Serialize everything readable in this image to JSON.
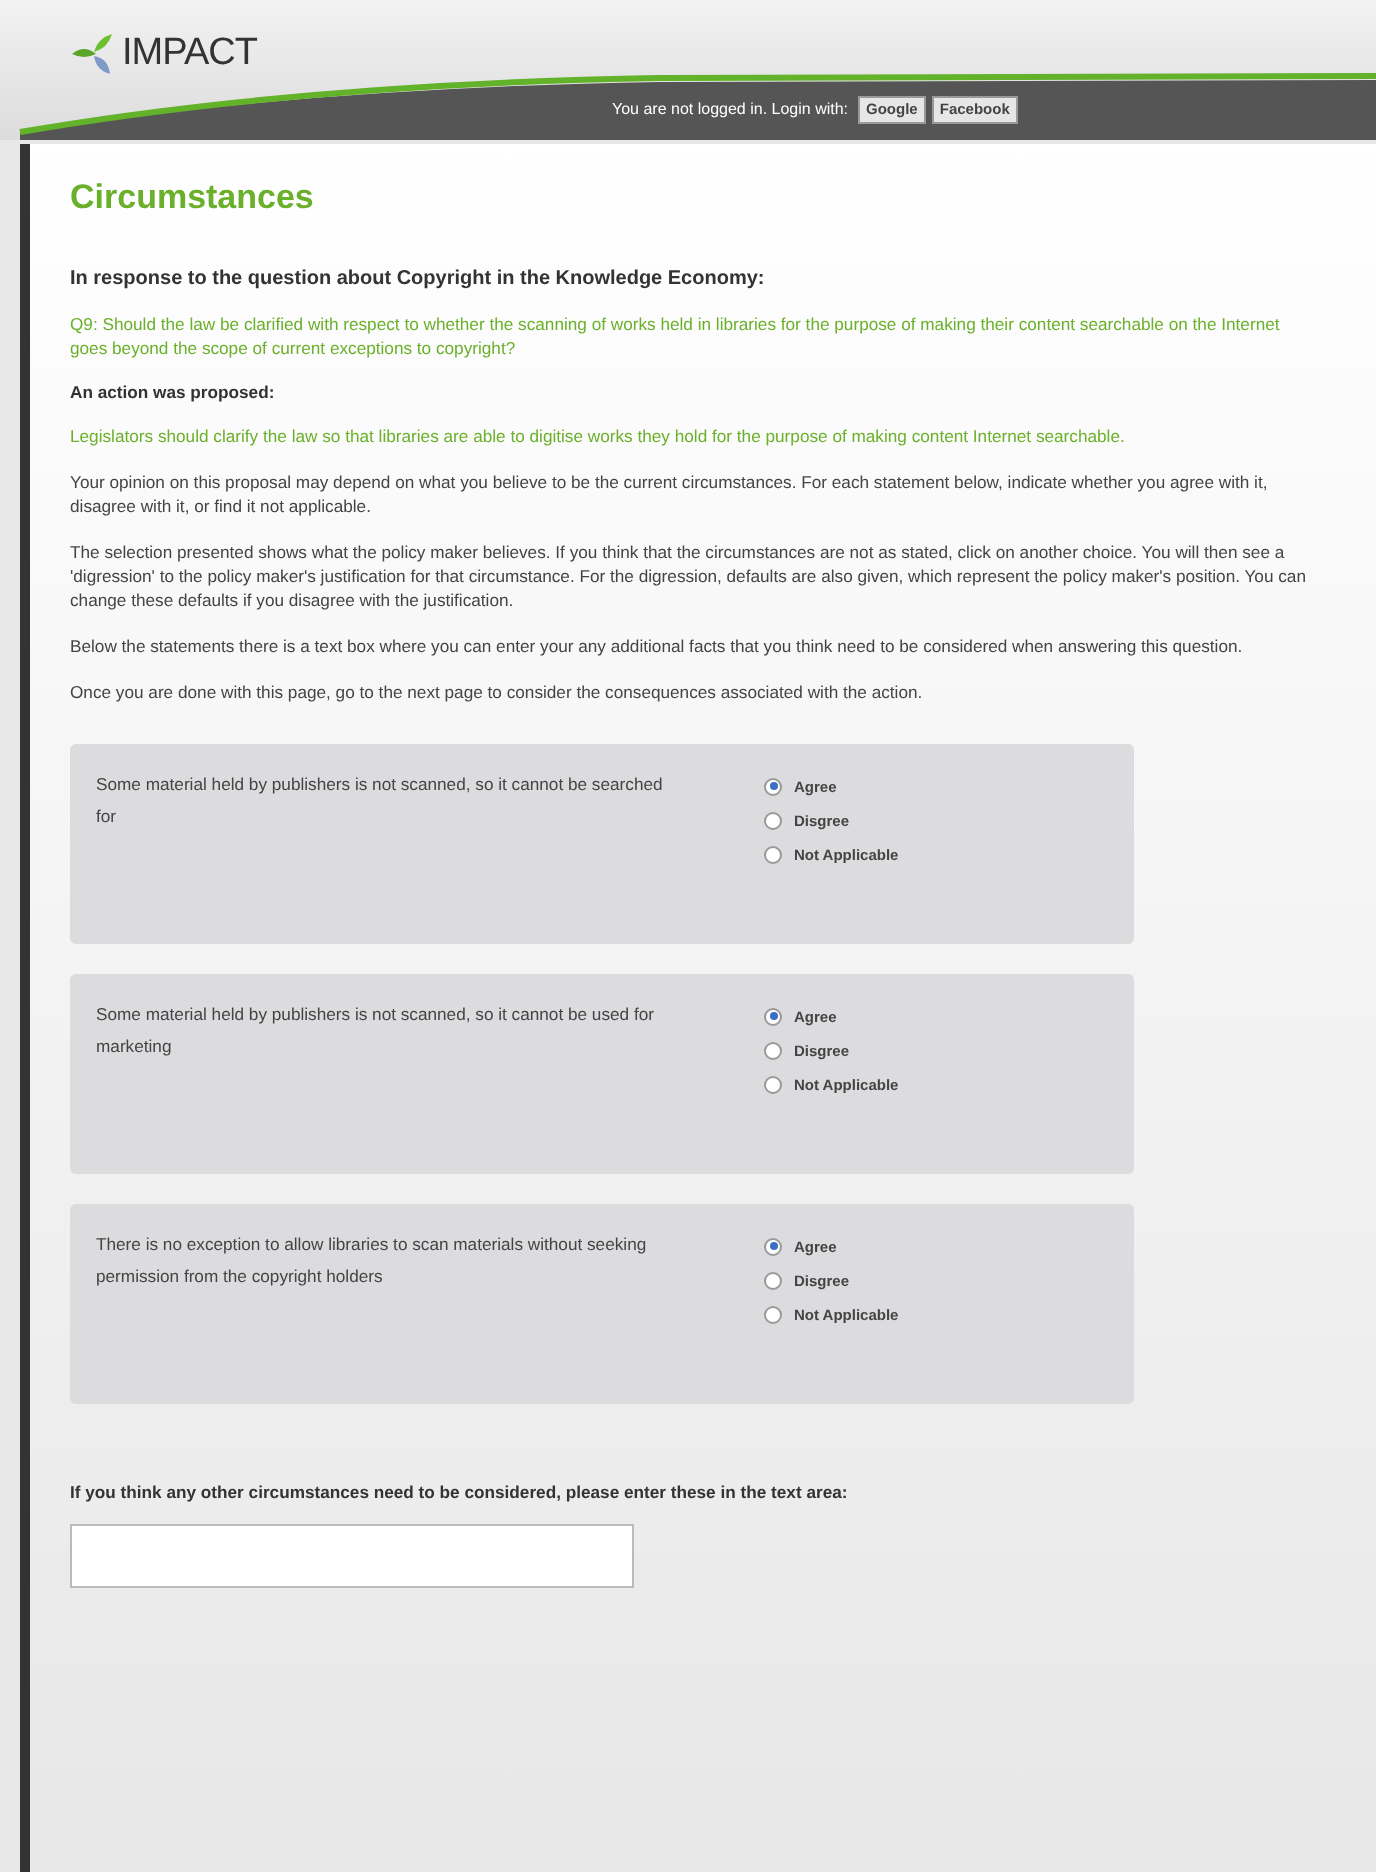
{
  "header": {
    "logo": "IMPACT",
    "login_text": "You are not logged in. Login with:",
    "login_buttons": [
      "Google",
      "Facebook"
    ]
  },
  "page": {
    "title": "Circumstances",
    "intro_heading": "In response to the question about Copyright in the Knowledge Economy:",
    "question": "Q9: Should the law be clarified with respect to whether the scanning of works held in libraries for the purpose of making their content searchable on the Internet goes beyond the scope of current exceptions to copyright?",
    "action_heading": "An action was proposed:",
    "action": "Legislators should clarify the law so that libraries are able to digitise works they hold for the purpose of making content Internet searchable.",
    "paragraphs": [
      "Your opinion on this proposal may depend on what you believe to be the current circumstances. For each statement below, indicate whether you agree with it, disagree with it, or find it not applicable.",
      "The selection presented shows what the policy maker believes. If you think that the circumstances are not as stated, click on another choice. You will then see a 'digression' to the policy maker's justification for that circumstance. For the digression, defaults are also given, which represent the policy maker's position. You can change these defaults if you disagree with the justification.",
      "Below the statements there is a text box where you can enter your any additional facts that you think need to be considered when answering this question.",
      "Once you are done with this page, go to the next page to consider the consequences associated with the action."
    ]
  },
  "statements": [
    {
      "text": "Some material held by publishers is not scanned, so it cannot be searched for",
      "options": [
        {
          "label": "Agree",
          "selected": true
        },
        {
          "label": "Disgree",
          "selected": false
        },
        {
          "label": "Not Applicable",
          "selected": false
        }
      ]
    },
    {
      "text": "Some material held by publishers is not scanned, so it cannot be used for marketing",
      "options": [
        {
          "label": "Agree",
          "selected": true
        },
        {
          "label": "Disgree",
          "selected": false
        },
        {
          "label": "Not Applicable",
          "selected": false
        }
      ]
    },
    {
      "text": "There is no exception to allow libraries to scan materials without seeking permission from the copyright holders",
      "options": [
        {
          "label": "Agree",
          "selected": true
        },
        {
          "label": "Disgree",
          "selected": false
        },
        {
          "label": "Not Applicable",
          "selected": false
        }
      ]
    }
  ],
  "other": {
    "label": "If you think any other circumstances need to be considered, please enter these in the text area:"
  }
}
